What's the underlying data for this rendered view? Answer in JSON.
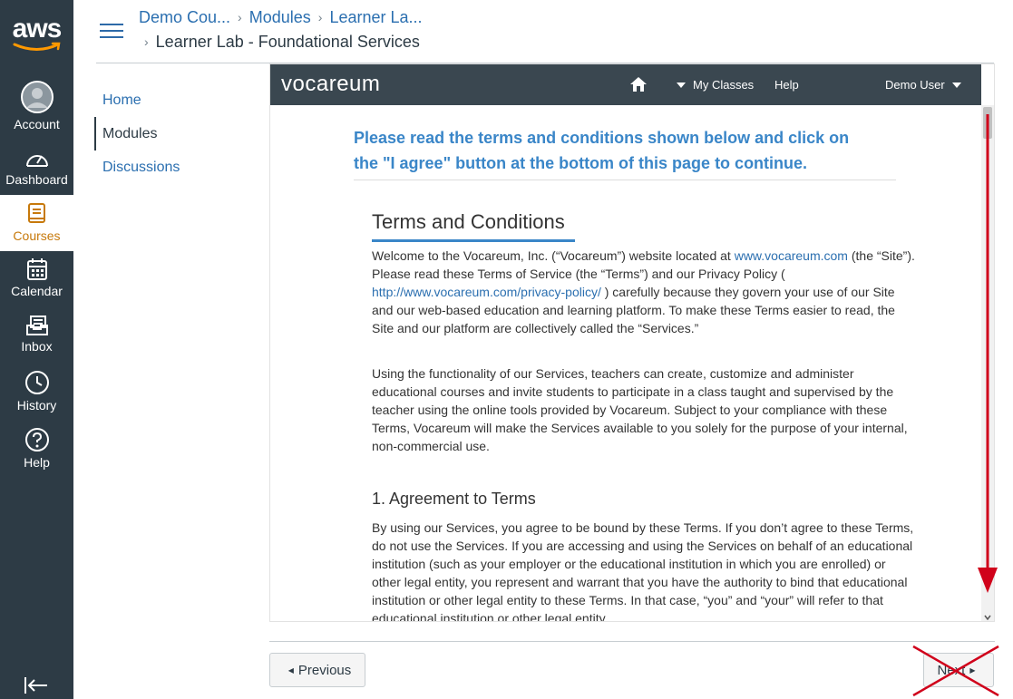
{
  "global_nav": {
    "logo_text": "aws",
    "items": [
      {
        "label": "Account",
        "icon": "account-icon"
      },
      {
        "label": "Dashboard",
        "icon": "dashboard-icon"
      },
      {
        "label": "Courses",
        "icon": "courses-icon"
      },
      {
        "label": "Calendar",
        "icon": "calendar-icon"
      },
      {
        "label": "Inbox",
        "icon": "inbox-icon"
      },
      {
        "label": "History",
        "icon": "history-icon"
      },
      {
        "label": "Help",
        "icon": "help-icon"
      }
    ],
    "active_color": "#c7790b",
    "bg_color": "#2d3b45"
  },
  "breadcrumb": {
    "items": [
      "Demo Cou...",
      "Modules",
      "Learner La..."
    ],
    "current": "Learner Lab - Foundational Services"
  },
  "course_nav": {
    "items": [
      {
        "label": "Home"
      },
      {
        "label": "Modules"
      },
      {
        "label": "Discussions"
      }
    ]
  },
  "vocareum": {
    "logo": "vocareum",
    "menu": {
      "my_classes": "My Classes",
      "help": "Help",
      "user": "Demo User"
    },
    "notice": "Please read the terms and conditions shown below and click on the \"I agree\" button at the bottom of this page to continue.",
    "terms_title": "Terms and Conditions",
    "intro": {
      "p1": "Welcome to the Vocareum, Inc. (“Vocareum”) website located at ",
      "link1": "www.vocareum.com",
      "p2": " (the “Site”). Please read these Terms of Service (the “Terms”) and our Privacy Policy ( ",
      "link2": "http://www.vocareum.com/privacy-policy/",
      "p3": " ) carefully because they govern your use of our Site and our web-based education and learning platform. To make these Terms easier to read, the Site and our platform are collectively called the “Services.”"
    },
    "para2": "Using the functionality of our Services, teachers can create, customize and administer educational courses and invite students to participate in a class taught and supervised by the teacher using the online tools provided by Vocareum. Subject to your compliance with these Terms, Vocareum will make the Services available to you solely for the purpose of your internal, non-commercial use.",
    "section1_title": "1. Agreement to Terms",
    "section1_text": "By using our Services, you agree to be bound by these Terms. If you don’t agree to these Terms, do not use the Services. If you are accessing and using the Services on behalf of an educational institution (such as your employer or the educational institution in which you are enrolled) or other legal entity, you represent and warrant that you have the authority to bind that educational institution or other legal entity to these Terms. In that case, “you” and “your” will refer to that educational institution or other legal entity."
  },
  "footer": {
    "previous": "Previous",
    "next": "Next"
  },
  "annotation_color": "#d0021b"
}
